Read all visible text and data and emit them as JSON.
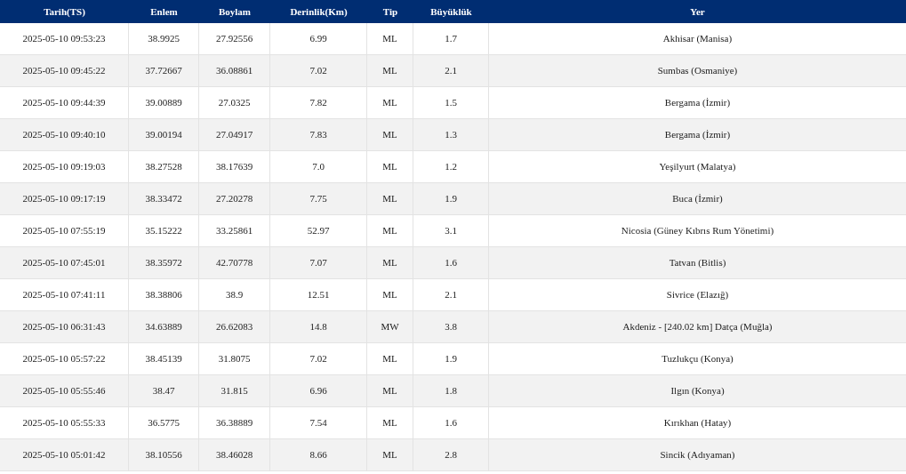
{
  "table": {
    "columns": [
      "Tarih(TS)",
      "Enlem",
      "Boylam",
      "Derinlik(Km)",
      "Tip",
      "Büyüklük",
      "Yer"
    ],
    "rows": [
      [
        "2025-05-10 09:53:23",
        "38.9925",
        "27.92556",
        "6.99",
        "ML",
        "1.7",
        "Akhisar (Manisa)"
      ],
      [
        "2025-05-10 09:45:22",
        "37.72667",
        "36.08861",
        "7.02",
        "ML",
        "2.1",
        "Sumbas (Osmaniye)"
      ],
      [
        "2025-05-10 09:44:39",
        "39.00889",
        "27.0325",
        "7.82",
        "ML",
        "1.5",
        "Bergama (İzmir)"
      ],
      [
        "2025-05-10 09:40:10",
        "39.00194",
        "27.04917",
        "7.83",
        "ML",
        "1.3",
        "Bergama (İzmir)"
      ],
      [
        "2025-05-10 09:19:03",
        "38.27528",
        "38.17639",
        "7.0",
        "ML",
        "1.2",
        "Yeşilyurt (Malatya)"
      ],
      [
        "2025-05-10 09:17:19",
        "38.33472",
        "27.20278",
        "7.75",
        "ML",
        "1.9",
        "Buca (İzmir)"
      ],
      [
        "2025-05-10 07:55:19",
        "35.15222",
        "33.25861",
        "52.97",
        "ML",
        "3.1",
        "Nicosia (Güney Kıbrıs Rum Yönetimi)"
      ],
      [
        "2025-05-10 07:45:01",
        "38.35972",
        "42.70778",
        "7.07",
        "ML",
        "1.6",
        "Tatvan (Bitlis)"
      ],
      [
        "2025-05-10 07:41:11",
        "38.38806",
        "38.9",
        "12.51",
        "ML",
        "2.1",
        "Sivrice (Elazığ)"
      ],
      [
        "2025-05-10 06:31:43",
        "34.63889",
        "26.62083",
        "14.8",
        "MW",
        "3.8",
        "Akdeniz - [240.02 km] Datça (Muğla)"
      ],
      [
        "2025-05-10 05:57:22",
        "38.45139",
        "31.8075",
        "7.02",
        "ML",
        "1.9",
        "Tuzlukçu (Konya)"
      ],
      [
        "2025-05-10 05:55:46",
        "38.47",
        "31.815",
        "6.96",
        "ML",
        "1.8",
        "Ilgın (Konya)"
      ],
      [
        "2025-05-10 05:55:33",
        "36.5775",
        "36.38889",
        "7.54",
        "ML",
        "1.6",
        "Kırıkhan (Hatay)"
      ],
      [
        "2025-05-10 05:01:42",
        "38.10556",
        "38.46028",
        "8.66",
        "ML",
        "2.8",
        "Sincik (Adıyaman)"
      ]
    ]
  }
}
